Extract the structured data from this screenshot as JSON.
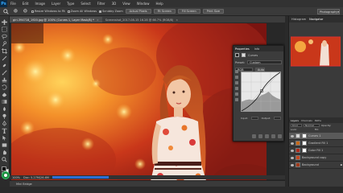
{
  "menu": {
    "app_logo": "Ps",
    "items": [
      "File",
      "Edit",
      "Image",
      "Layer",
      "Type",
      "Select",
      "Filter",
      "3D",
      "View",
      "Window",
      "Help"
    ]
  },
  "options": {
    "resize_windows": "Resize Windows to Fit",
    "zoom_all": "Zoom All Windows",
    "scrubby_zoom": "Scrubby Zoom",
    "actual_pixels": "Actual Pixels",
    "fit_screen": "Fit Screen",
    "fill_screen": "Fill Screen",
    "print_size": "Print Size",
    "workspace": "Photography"
  },
  "document": {
    "tab_active": "girl-394718_1920.jpg @ 100% (Curves 1, Layer Mask/8) *",
    "tab_2": "Screenshot_2017-08-15 16.28 @ 66.7% (RGB/8)",
    "zoom": "100%",
    "doc_info": "Doc: 5.27M/26.6M",
    "mini_bridge": "Mini Bridge"
  },
  "properties": {
    "tabs": [
      "Properties",
      "Info"
    ],
    "title": "Curves",
    "preset_label": "Preset:",
    "preset_value": "Custom",
    "channel_value": "RGB",
    "auto_label": "Auto",
    "input_label": "Input:",
    "output_label": "Output:"
  },
  "right": {
    "top_tabs": [
      "Histogram",
      "Navigator"
    ],
    "layers_tabs": [
      "Layers",
      "Channels",
      "Paths"
    ],
    "kind_label": "Kind",
    "blend_mode": "Normal",
    "opacity_label": "Opacity:",
    "lock_label": "Lock:",
    "fill_label": "Fill:",
    "layers": [
      {
        "name": "Curves 1",
        "selected": true,
        "thumb_color": "#d7d7d7"
      },
      {
        "name": "Gradient Fill 1",
        "selected": false,
        "thumb_color": "#c96a1a"
      },
      {
        "name": "Color Fill 1",
        "selected": false,
        "thumb_color": "#b02a1a"
      },
      {
        "name": "Background copy",
        "selected": false,
        "thumb_color": "#c4471e"
      },
      {
        "name": "Background",
        "selected": false,
        "thumb_color": "#a13a1b"
      }
    ]
  },
  "colors": {
    "accent": "#2d6fd6",
    "image_warm": "#d8461c",
    "image_glow": "#ffd24a"
  }
}
